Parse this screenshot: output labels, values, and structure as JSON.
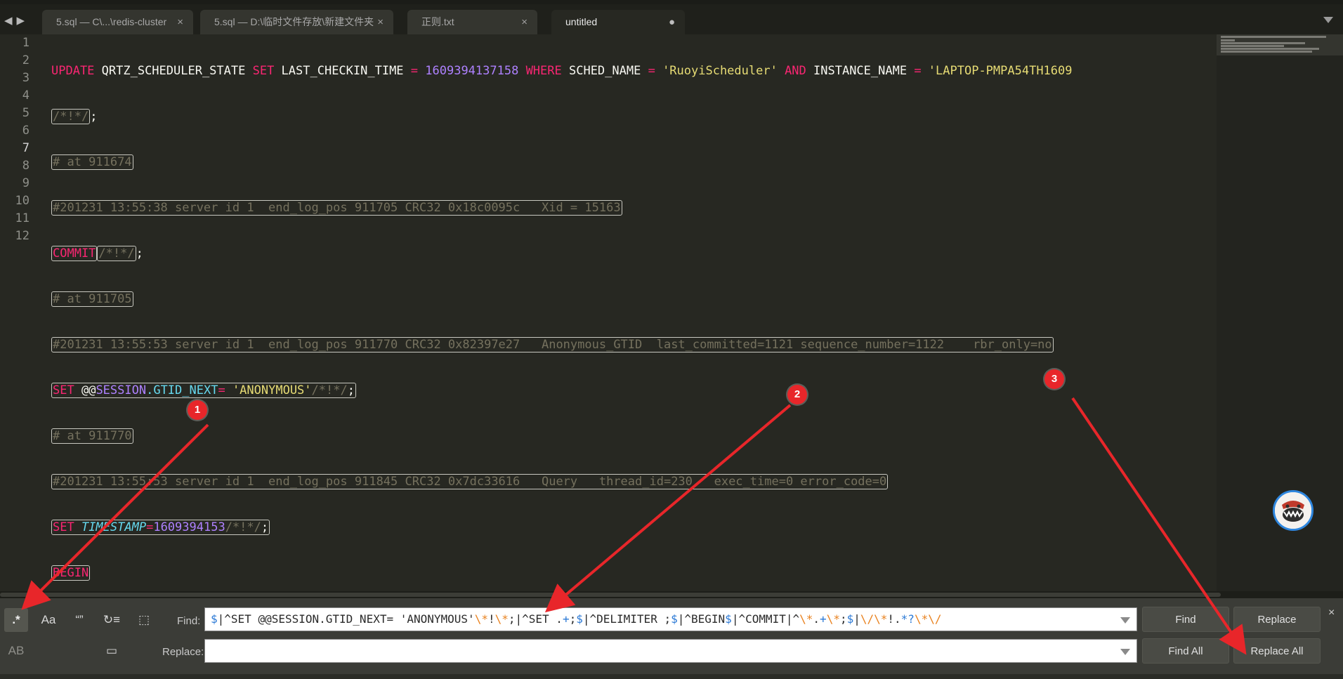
{
  "tabs": [
    {
      "label": "5.sql — C\\...\\redis-cluster",
      "close": "×"
    },
    {
      "label": "5.sql — D:\\临时文件存放\\新建文件夹",
      "close": "×"
    },
    {
      "label": "正则.txt",
      "close": "×"
    },
    {
      "label": "untitled",
      "dirty": "●"
    }
  ],
  "nav": {
    "back": "◀",
    "forward": "▶"
  },
  "line_numbers": [
    "1",
    "2",
    "3",
    "4",
    "5",
    "6",
    "7",
    "8",
    "9",
    "10",
    "11",
    "12"
  ],
  "code": {
    "l1": {
      "k1": "UPDATE",
      "t1": " QRTZ_SCHEDULER_STATE ",
      "k2": "SET",
      "t2": " LAST_CHECKIN_TIME ",
      "op1": "=",
      "n1": " 1609394137158",
      "k3": " WHERE",
      "t3": " SCHED_NAME ",
      "op2": "=",
      "s1": " 'RuoyiScheduler'",
      "k4": " AND",
      "t4": " INSTANCE_NAME ",
      "op3": "=",
      "s2": " 'LAPTOP-PMPA54TH1609"
    },
    "l2": {
      "c": "/*!*/",
      "t": ";"
    },
    "l3": {
      "c": "# at 911674"
    },
    "l4": {
      "c": "#201231 13:55:38 server id 1  end_log_pos 911705 CRC32 0x18c0095c   Xid = 15163"
    },
    "l5": {
      "k": "COMMIT",
      "c": "/*!*/",
      "t": ";"
    },
    "l6": {
      "c": "# at 911705"
    },
    "l7": {
      "c": "#201231 13:55:53 server id 1  end_log_pos 911770 CRC32 0x82397e27   Anonymous_GTID  last_committed=1121 sequence_number=1122    rbr_only=no"
    },
    "l8": {
      "k": "SET",
      "t1": " @@",
      "v": "SESSION",
      "t2": ".GTID_NEXT",
      "op": "=",
      "s": " 'ANONYMOUS'",
      "c": "/*!*/",
      "t3": ";"
    },
    "l9": {
      "c": "# at 911770"
    },
    "l10": {
      "c": "#201231 13:55:53 server id 1  end_log_pos 911845 CRC32 0x7dc33616   Query   thread_id=230   exec_time=0 error_code=0"
    },
    "l11": {
      "k": "SET",
      "v": " TIMESTAMP",
      "op": "=",
      "n": "1609394153",
      "c": "/*!*/",
      "t": ";"
    },
    "l12": {
      "k": "BEGIN"
    }
  },
  "find_panel": {
    "options": {
      "regex": ".*",
      "case": "Aa",
      "whole_word": "“”",
      "wrap": "↻≡",
      "in_selection": "⬚",
      "preserve_case": "AB",
      "highlight": "▭"
    },
    "find_label": "Find:",
    "replace_label": "Replace:",
    "find_value": {
      "p1": "$",
      "p2": "|^SET @@SESSION.GTID_NEXT= 'ANONYMOUS'",
      "p3": "\\*",
      "p4": "!",
      "p5": "\\*",
      "p6": ";",
      "p7": "|^SET .",
      "p8": "+",
      "p9": ";",
      "p10": "$",
      "p11": "|^DELIMITER ;",
      "p12": "$",
      "p13": "|^BEGIN",
      "p14": "$",
      "p15": "|^COMMIT|^",
      "p16": "\\*",
      "p17": ".",
      "p18": "+",
      "p19": "\\*",
      "p20": ";",
      "p21": "$",
      "p22": "|",
      "p23": "\\/\\*",
      "p24": "!.",
      "p25": "*?",
      "p26": "\\*\\/"
    },
    "replace_value": "",
    "buttons": {
      "find": "Find",
      "replace": "Replace",
      "find_all": "Find All",
      "replace_all": "Replace All"
    },
    "close": "×"
  },
  "annotations": [
    "1",
    "2",
    "3"
  ],
  "colors": {
    "annotation": "#e8262a",
    "keyword": "#f92672",
    "number": "#ae81ff",
    "string": "#e6db74",
    "comment": "#75715e",
    "variable": "#66d9ef"
  }
}
